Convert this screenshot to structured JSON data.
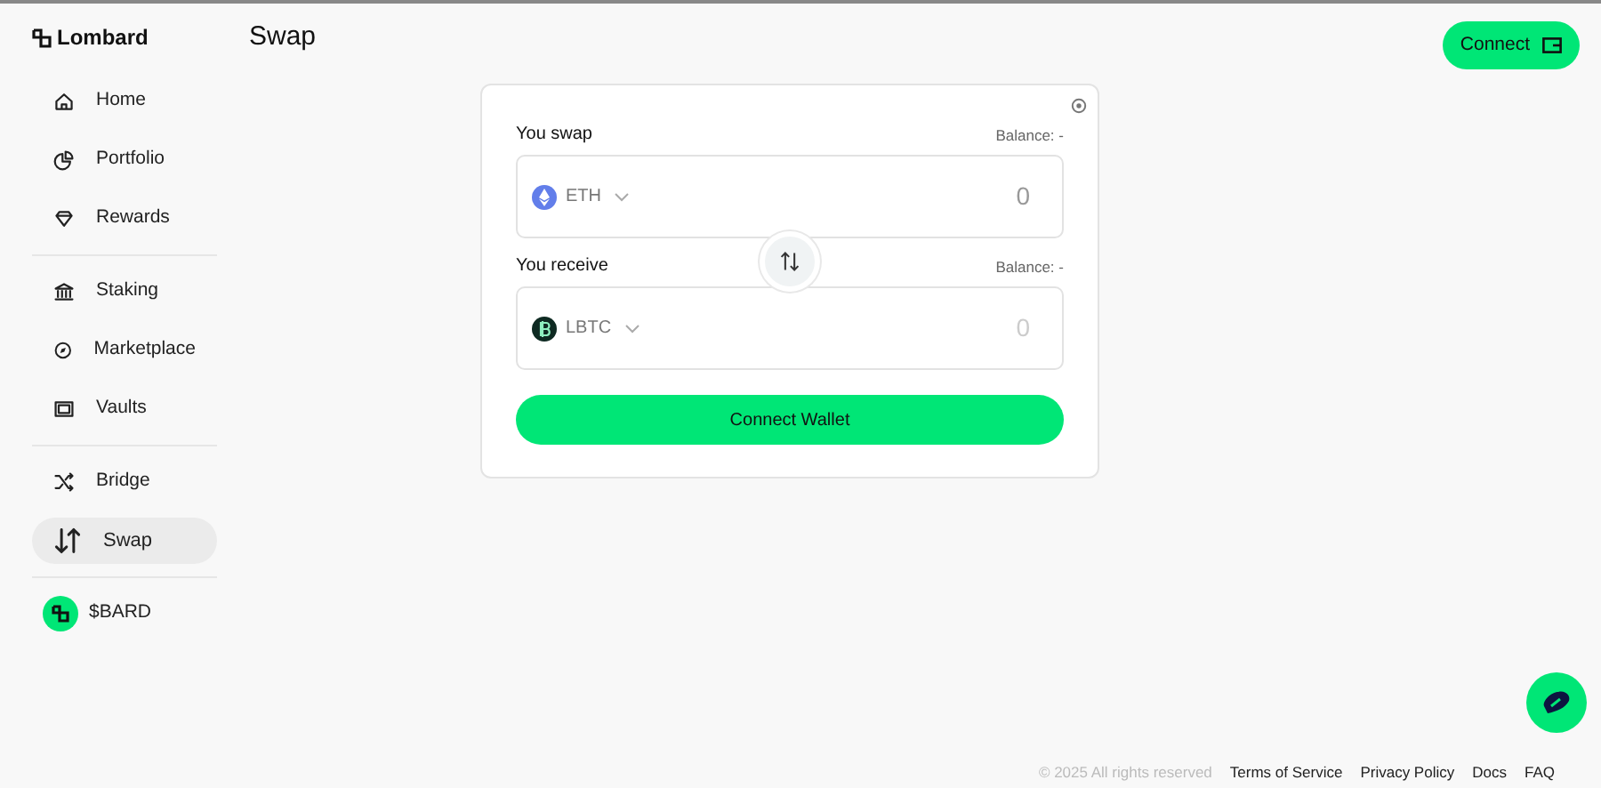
{
  "brand": {
    "name": "Lombard"
  },
  "page_title": "Swap",
  "header_button": {
    "label": "Connect"
  },
  "sidebar": {
    "groups": [
      {
        "items": [
          {
            "label": "Home",
            "selected": false
          },
          {
            "label": "Portfolio",
            "selected": false
          },
          {
            "label": "Rewards",
            "selected": false
          }
        ]
      },
      {
        "items": [
          {
            "label": "Staking",
            "selected": false
          },
          {
            "label": "Marketplace",
            "selected": false
          },
          {
            "label": "Vaults",
            "selected": false
          }
        ]
      },
      {
        "items": [
          {
            "label": "Bridge",
            "selected": false
          },
          {
            "label": "Swap",
            "selected": true
          }
        ]
      }
    ],
    "token_item": {
      "label": "$BARD"
    }
  },
  "swap": {
    "from": {
      "label": "You swap",
      "balance": "Balance: -",
      "token": "ETH",
      "amount": "0"
    },
    "to": {
      "label": "You receive",
      "balance": "Balance: -",
      "token": "LBTC",
      "amount": "0"
    },
    "action": "Connect Wallet"
  },
  "footer": {
    "copyright": "© 2025 All rights reserved",
    "links": [
      "Terms of Service",
      "Privacy Policy",
      "Docs",
      "FAQ"
    ]
  }
}
